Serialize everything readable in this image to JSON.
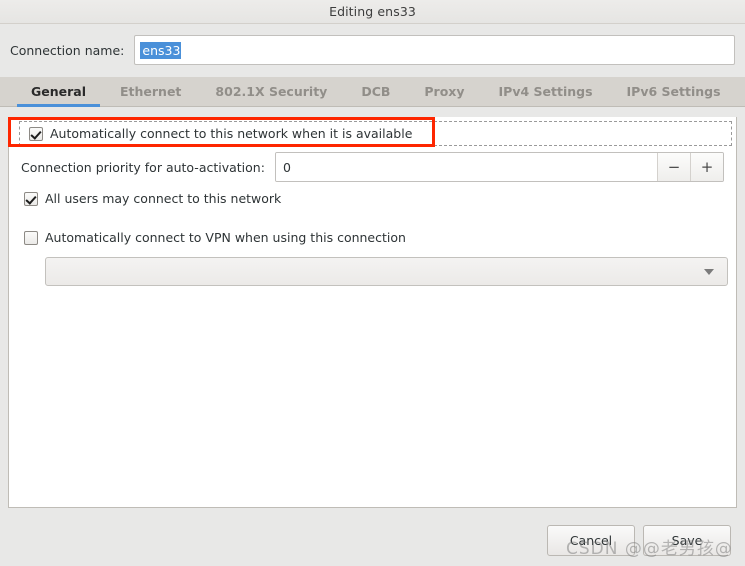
{
  "window": {
    "title": "Editing ens33"
  },
  "connection_name": {
    "label": "Connection name:",
    "value": "ens33"
  },
  "tabs": [
    {
      "label": "General",
      "active": true
    },
    {
      "label": "Ethernet",
      "active": false
    },
    {
      "label": "802.1X Security",
      "active": false
    },
    {
      "label": "DCB",
      "active": false
    },
    {
      "label": "Proxy",
      "active": false
    },
    {
      "label": "IPv4 Settings",
      "active": false
    },
    {
      "label": "IPv6 Settings",
      "active": false
    }
  ],
  "general": {
    "auto_connect": {
      "label": "Automatically connect to this network when it is available",
      "checked": true
    },
    "priority": {
      "label": "Connection priority for auto-activation:",
      "value": "0",
      "decrement_label": "−",
      "increment_label": "+"
    },
    "all_users": {
      "label": "All users may connect to this network",
      "checked": true
    },
    "auto_vpn": {
      "label": "Automatically connect to VPN when using this connection",
      "checked": false
    },
    "vpn_combo": {
      "value": "",
      "arrow_icon": "chevron-down-icon"
    }
  },
  "footer": {
    "cancel_label": "Cancel",
    "save_label": "Save"
  },
  "annotation": {
    "color": "#fe2600"
  },
  "watermark": {
    "text": "CSDN @@老男孩@"
  }
}
